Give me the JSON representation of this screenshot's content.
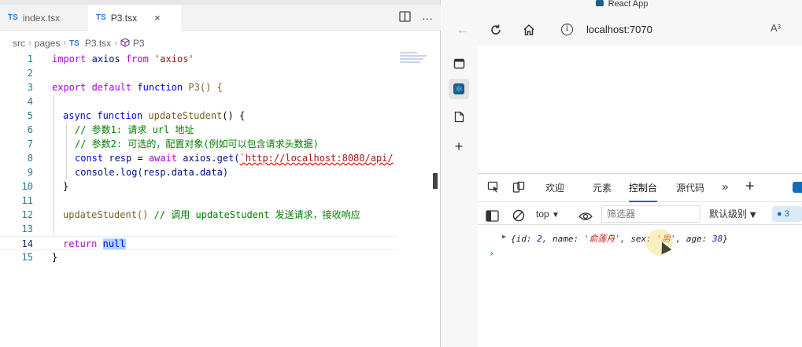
{
  "vscode": {
    "tabs": [
      {
        "badge": "TS",
        "label": "index.tsx",
        "active": false
      },
      {
        "badge": "TS",
        "label": "P3.tsx",
        "active": true
      }
    ],
    "tab_close": "×",
    "breadcrumb": {
      "parts": [
        "src",
        "pages"
      ],
      "file_badge": "TS",
      "file": "P3.tsx",
      "symbol": "P3"
    },
    "code_lines": [
      {
        "n": "1"
      },
      {
        "n": "2"
      },
      {
        "n": "3"
      },
      {
        "n": "4"
      },
      {
        "n": "5"
      },
      {
        "n": "6"
      },
      {
        "n": "7"
      },
      {
        "n": "8"
      },
      {
        "n": "9"
      },
      {
        "n": "10"
      },
      {
        "n": "11"
      },
      {
        "n": "12"
      },
      {
        "n": "13"
      },
      {
        "n": "14"
      },
      {
        "n": "15"
      }
    ],
    "code": {
      "l1_import": "import",
      "l1_axios": " axios ",
      "l1_from": "from",
      "l1_str": " 'axios'",
      "l3_export": "export",
      "l3_default": " default ",
      "l3_function": "function",
      "l3_rest": " P3() {",
      "l5_async": "async",
      "l5_function": " function ",
      "l5_name": "updateStudent",
      "l5_rest": "() {",
      "l6_comment": "// 参数1: 请求 url 地址",
      "l7_comment": "// 参数2: 可选的，配置对象(例如可以包含请求头数据)",
      "l8_const": "const",
      "l8_resp": " resp ",
      "l8_eq": "= ",
      "l8_await": "await",
      "l8_call": " axios.get(",
      "l8_url": "`http://localhost:8080/api/",
      "l9_code": "console.log(resp.data.data)",
      "l10_code": "}",
      "l12_call": "updateStudent() ",
      "l12_comment": "// 调用 updateStudent 发送请求，接收响应",
      "l14_return": "return",
      "l14_null": "null",
      "l15_code": "}"
    }
  },
  "browser": {
    "window_title": "React App",
    "url": "localhost:7070",
    "read_aloud": "A³",
    "devtools": {
      "tabs": [
        "欢迎",
        "元素",
        "控制台",
        "源代码"
      ],
      "active_tab": "控制台",
      "context": "top",
      "filter_placeholder": "筛选器",
      "level": "默认级别",
      "issues_count": "3",
      "log": {
        "open": "{",
        "id_key": "id: ",
        "id_val": "2",
        "name_key": ", name: ",
        "name_val": "'俞莲舟'",
        "sex_key": ", sex: ",
        "sex_val": "'男'",
        "age_key": ", age: ",
        "age_val": "38",
        "close": "}"
      },
      "prompt": "›"
    }
  },
  "colors": {
    "keyword": "#0000ff",
    "control_keyword": "#af00db",
    "function": "#795e26",
    "string": "#a31515",
    "comment": "#008000",
    "accent": "#0f6cbd"
  }
}
